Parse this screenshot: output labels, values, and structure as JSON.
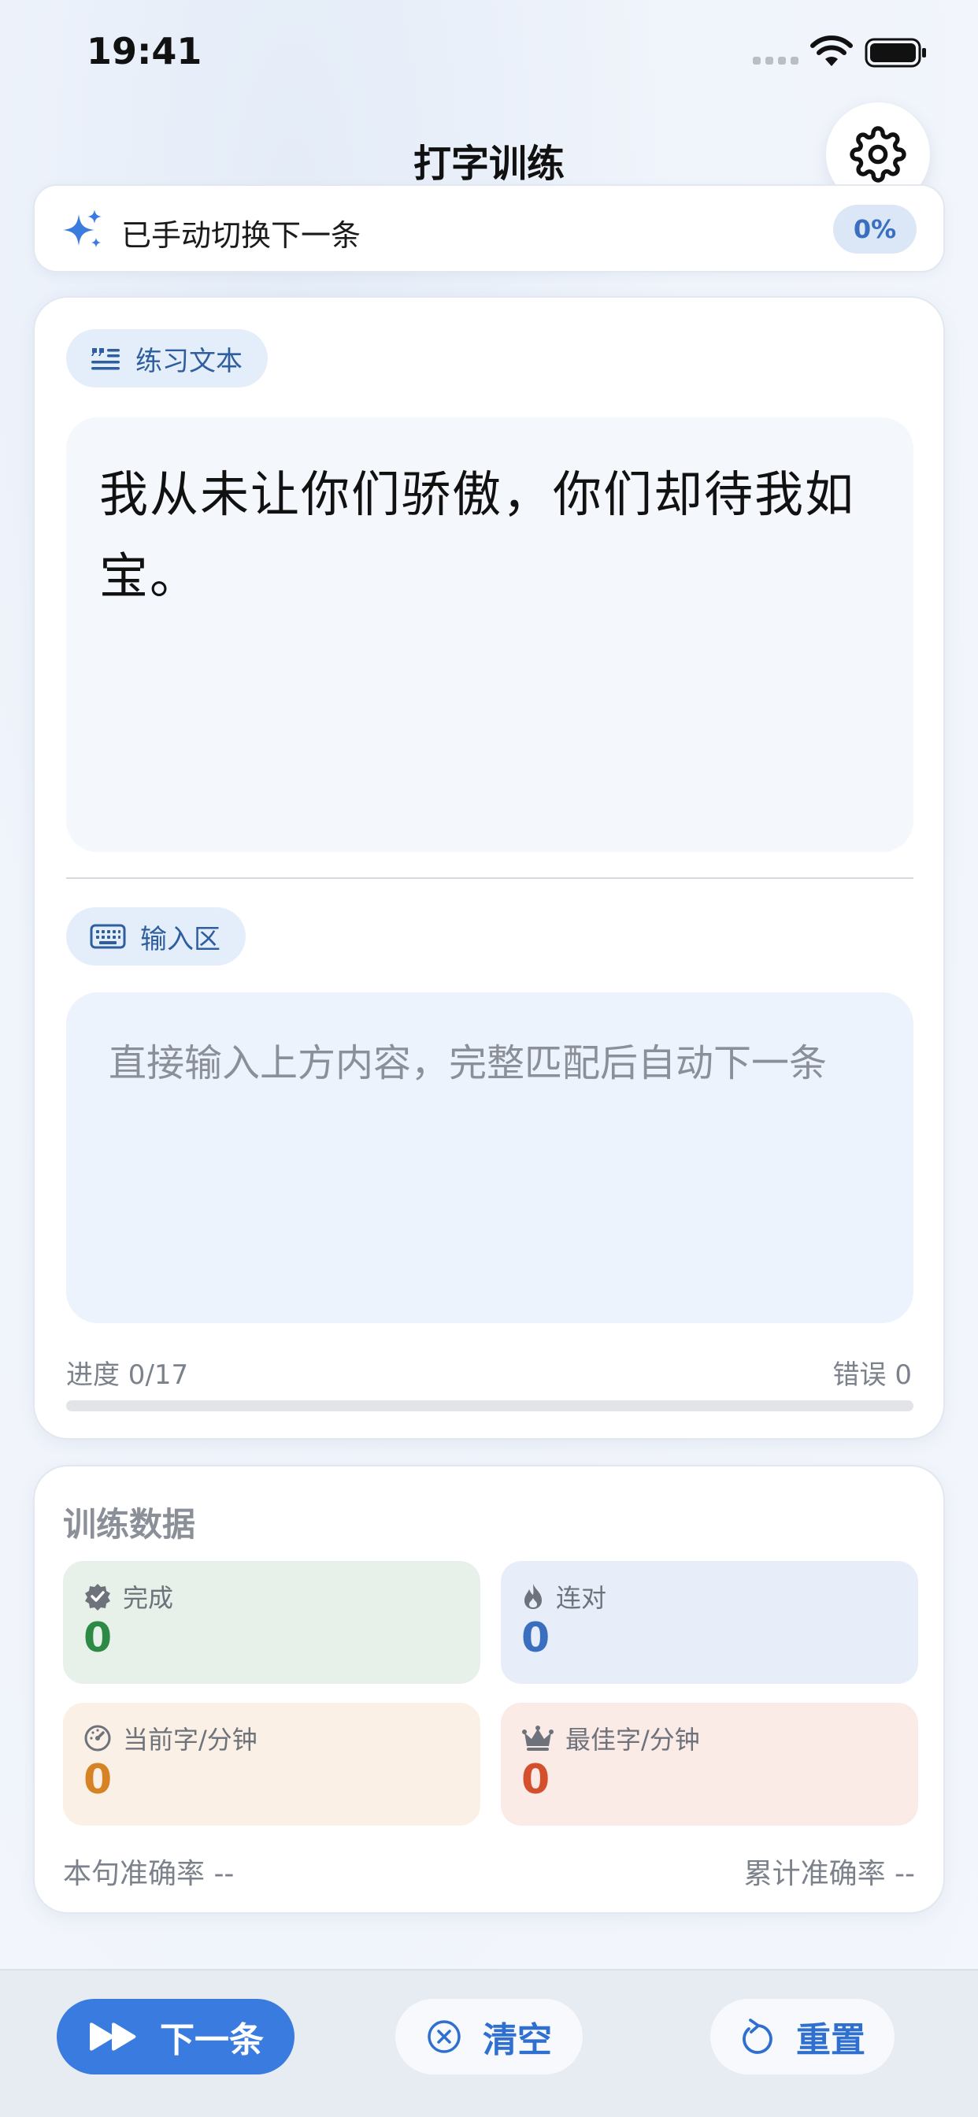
{
  "status_bar": {
    "time": "19:41"
  },
  "header": {
    "title": "打字训练"
  },
  "notice": {
    "text": "已手动切换下一条",
    "percent": "0%"
  },
  "practice": {
    "text_chip": "练习文本",
    "prompt": "我从未让你们骄傲，你们却待我如宝。",
    "input_chip": "输入区",
    "input_placeholder": "直接输入上方内容，完整匹配后自动下一条",
    "input_value": "",
    "progress_label": "进度 0/17",
    "progress_fraction": 0,
    "error_label": "错误 0"
  },
  "stats": {
    "title": "训练数据",
    "done_label": "完成",
    "done_value": "0",
    "streak_label": "连对",
    "streak_value": "0",
    "wpm_label": "当前字/分钟",
    "wpm_value": "0",
    "best_label": "最佳字/分钟",
    "best_value": "0",
    "sentence_accuracy": "本句准确率 --",
    "total_accuracy": "累计准确率 --"
  },
  "bottom": {
    "next_label": "下一条",
    "clear_label": "清空",
    "reset_label": "重置"
  },
  "colors": {
    "accent": "#3a7be0",
    "done": "#2d8a45",
    "streak": "#3a6fc0",
    "wpm": "#d58324",
    "best": "#d4502c"
  },
  "icons": [
    "wifi-icon",
    "battery-icon",
    "gear-icon",
    "sparkle-icon",
    "quote-list-icon",
    "keyboard-icon",
    "verified-icon",
    "flame-icon",
    "speedometer-icon",
    "crown-icon",
    "fast-forward-icon",
    "clear-circle-icon",
    "reset-icon"
  ]
}
